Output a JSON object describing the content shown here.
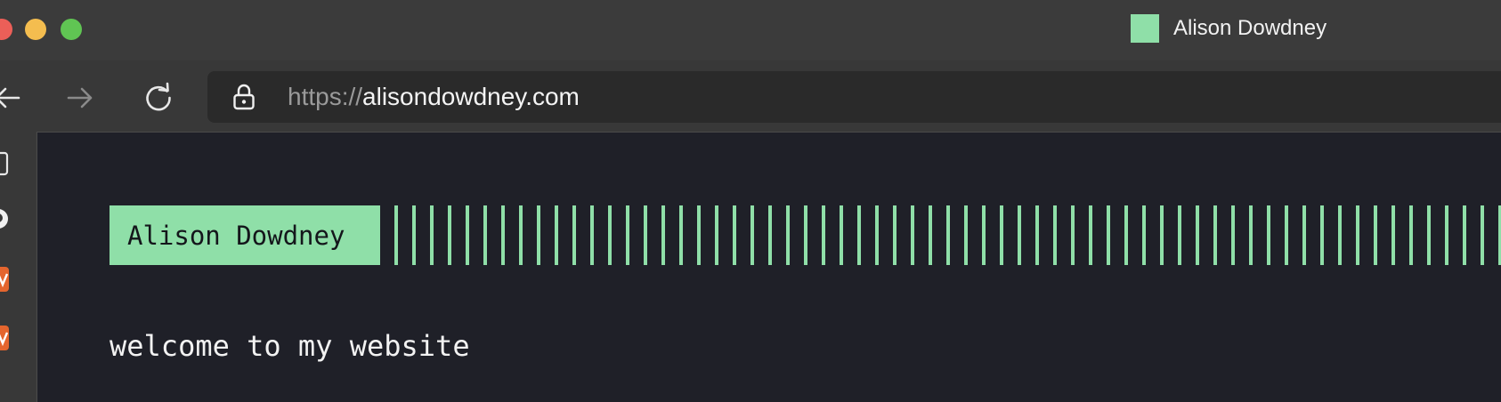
{
  "browser": {
    "tab": {
      "title": "Alison Dowdney",
      "favicon_color": "#8fdfa8"
    },
    "address_bar": {
      "scheme": "https://",
      "host": "alisondowdney.com"
    },
    "nav": {
      "back_icon": "arrow-left-icon",
      "forward_icon": "arrow-right-icon",
      "reload_icon": "reload-icon"
    },
    "sidebar_icons": [
      "page-icon",
      "github-icon",
      "app-icon-orange",
      "app-icon-orange"
    ]
  },
  "page": {
    "name": "Alison Dowdney",
    "welcome": "welcome to my website",
    "accent_color": "#8fdfa8",
    "background_color": "#1f2028"
  }
}
